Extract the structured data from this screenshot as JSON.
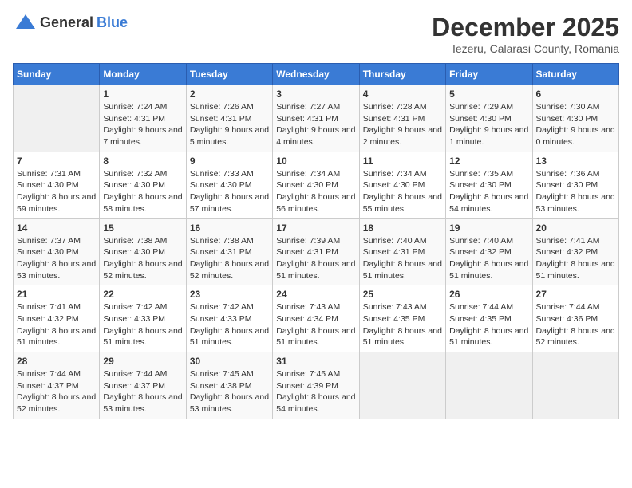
{
  "app": {
    "logo_general": "General",
    "logo_blue": "Blue"
  },
  "header": {
    "month": "December 2025",
    "location": "Iezeru, Calarasi County, Romania"
  },
  "days_of_week": [
    "Sunday",
    "Monday",
    "Tuesday",
    "Wednesday",
    "Thursday",
    "Friday",
    "Saturday"
  ],
  "weeks": [
    [
      {
        "day": "",
        "info": ""
      },
      {
        "day": "1",
        "sunrise": "Sunrise: 7:24 AM",
        "sunset": "Sunset: 4:31 PM",
        "daylight": "Daylight: 9 hours and 7 minutes."
      },
      {
        "day": "2",
        "sunrise": "Sunrise: 7:26 AM",
        "sunset": "Sunset: 4:31 PM",
        "daylight": "Daylight: 9 hours and 5 minutes."
      },
      {
        "day": "3",
        "sunrise": "Sunrise: 7:27 AM",
        "sunset": "Sunset: 4:31 PM",
        "daylight": "Daylight: 9 hours and 4 minutes."
      },
      {
        "day": "4",
        "sunrise": "Sunrise: 7:28 AM",
        "sunset": "Sunset: 4:31 PM",
        "daylight": "Daylight: 9 hours and 2 minutes."
      },
      {
        "day": "5",
        "sunrise": "Sunrise: 7:29 AM",
        "sunset": "Sunset: 4:30 PM",
        "daylight": "Daylight: 9 hours and 1 minute."
      },
      {
        "day": "6",
        "sunrise": "Sunrise: 7:30 AM",
        "sunset": "Sunset: 4:30 PM",
        "daylight": "Daylight: 9 hours and 0 minutes."
      }
    ],
    [
      {
        "day": "7",
        "sunrise": "Sunrise: 7:31 AM",
        "sunset": "Sunset: 4:30 PM",
        "daylight": "Daylight: 8 hours and 59 minutes."
      },
      {
        "day": "8",
        "sunrise": "Sunrise: 7:32 AM",
        "sunset": "Sunset: 4:30 PM",
        "daylight": "Daylight: 8 hours and 58 minutes."
      },
      {
        "day": "9",
        "sunrise": "Sunrise: 7:33 AM",
        "sunset": "Sunset: 4:30 PM",
        "daylight": "Daylight: 8 hours and 57 minutes."
      },
      {
        "day": "10",
        "sunrise": "Sunrise: 7:34 AM",
        "sunset": "Sunset: 4:30 PM",
        "daylight": "Daylight: 8 hours and 56 minutes."
      },
      {
        "day": "11",
        "sunrise": "Sunrise: 7:34 AM",
        "sunset": "Sunset: 4:30 PM",
        "daylight": "Daylight: 8 hours and 55 minutes."
      },
      {
        "day": "12",
        "sunrise": "Sunrise: 7:35 AM",
        "sunset": "Sunset: 4:30 PM",
        "daylight": "Daylight: 8 hours and 54 minutes."
      },
      {
        "day": "13",
        "sunrise": "Sunrise: 7:36 AM",
        "sunset": "Sunset: 4:30 PM",
        "daylight": "Daylight: 8 hours and 53 minutes."
      }
    ],
    [
      {
        "day": "14",
        "sunrise": "Sunrise: 7:37 AM",
        "sunset": "Sunset: 4:30 PM",
        "daylight": "Daylight: 8 hours and 53 minutes."
      },
      {
        "day": "15",
        "sunrise": "Sunrise: 7:38 AM",
        "sunset": "Sunset: 4:30 PM",
        "daylight": "Daylight: 8 hours and 52 minutes."
      },
      {
        "day": "16",
        "sunrise": "Sunrise: 7:38 AM",
        "sunset": "Sunset: 4:31 PM",
        "daylight": "Daylight: 8 hours and 52 minutes."
      },
      {
        "day": "17",
        "sunrise": "Sunrise: 7:39 AM",
        "sunset": "Sunset: 4:31 PM",
        "daylight": "Daylight: 8 hours and 51 minutes."
      },
      {
        "day": "18",
        "sunrise": "Sunrise: 7:40 AM",
        "sunset": "Sunset: 4:31 PM",
        "daylight": "Daylight: 8 hours and 51 minutes."
      },
      {
        "day": "19",
        "sunrise": "Sunrise: 7:40 AM",
        "sunset": "Sunset: 4:32 PM",
        "daylight": "Daylight: 8 hours and 51 minutes."
      },
      {
        "day": "20",
        "sunrise": "Sunrise: 7:41 AM",
        "sunset": "Sunset: 4:32 PM",
        "daylight": "Daylight: 8 hours and 51 minutes."
      }
    ],
    [
      {
        "day": "21",
        "sunrise": "Sunrise: 7:41 AM",
        "sunset": "Sunset: 4:32 PM",
        "daylight": "Daylight: 8 hours and 51 minutes."
      },
      {
        "day": "22",
        "sunrise": "Sunrise: 7:42 AM",
        "sunset": "Sunset: 4:33 PM",
        "daylight": "Daylight: 8 hours and 51 minutes."
      },
      {
        "day": "23",
        "sunrise": "Sunrise: 7:42 AM",
        "sunset": "Sunset: 4:33 PM",
        "daylight": "Daylight: 8 hours and 51 minutes."
      },
      {
        "day": "24",
        "sunrise": "Sunrise: 7:43 AM",
        "sunset": "Sunset: 4:34 PM",
        "daylight": "Daylight: 8 hours and 51 minutes."
      },
      {
        "day": "25",
        "sunrise": "Sunrise: 7:43 AM",
        "sunset": "Sunset: 4:35 PM",
        "daylight": "Daylight: 8 hours and 51 minutes."
      },
      {
        "day": "26",
        "sunrise": "Sunrise: 7:44 AM",
        "sunset": "Sunset: 4:35 PM",
        "daylight": "Daylight: 8 hours and 51 minutes."
      },
      {
        "day": "27",
        "sunrise": "Sunrise: 7:44 AM",
        "sunset": "Sunset: 4:36 PM",
        "daylight": "Daylight: 8 hours and 52 minutes."
      }
    ],
    [
      {
        "day": "28",
        "sunrise": "Sunrise: 7:44 AM",
        "sunset": "Sunset: 4:37 PM",
        "daylight": "Daylight: 8 hours and 52 minutes."
      },
      {
        "day": "29",
        "sunrise": "Sunrise: 7:44 AM",
        "sunset": "Sunset: 4:37 PM",
        "daylight": "Daylight: 8 hours and 53 minutes."
      },
      {
        "day": "30",
        "sunrise": "Sunrise: 7:45 AM",
        "sunset": "Sunset: 4:38 PM",
        "daylight": "Daylight: 8 hours and 53 minutes."
      },
      {
        "day": "31",
        "sunrise": "Sunrise: 7:45 AM",
        "sunset": "Sunset: 4:39 PM",
        "daylight": "Daylight: 8 hours and 54 minutes."
      },
      {
        "day": "",
        "info": ""
      },
      {
        "day": "",
        "info": ""
      },
      {
        "day": "",
        "info": ""
      }
    ]
  ]
}
